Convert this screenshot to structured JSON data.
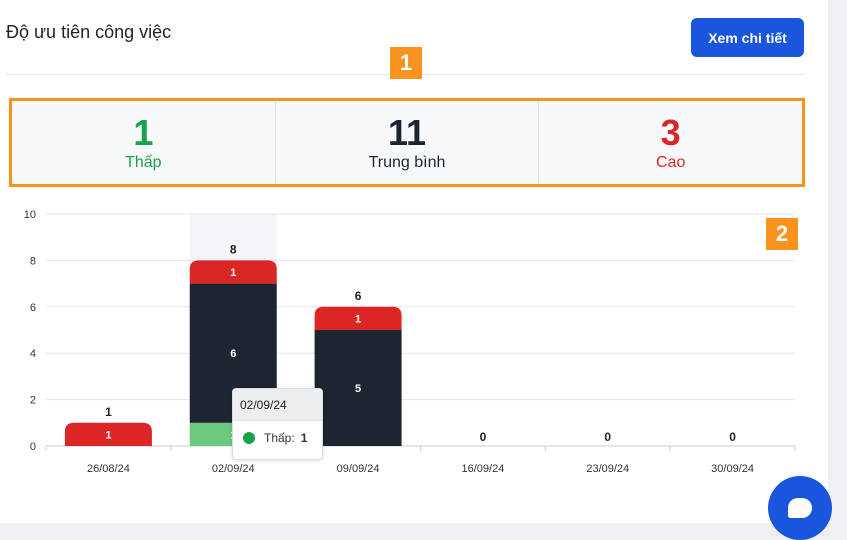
{
  "header": {
    "title": "Độ ưu tiên công việc",
    "detail_button": "Xem chi tiết"
  },
  "markers": {
    "summary": "1",
    "chart": "2"
  },
  "summary": [
    {
      "value": "1",
      "label": "Thấp",
      "color": "#16a34a"
    },
    {
      "value": "11",
      "label": "Trung bình",
      "color": "#1e2532"
    },
    {
      "value": "3",
      "label": "Cao",
      "color": "#dc2626"
    }
  ],
  "chart_data": {
    "type": "bar",
    "stacked": true,
    "categories": [
      "26/08/24",
      "02/09/24",
      "09/09/24",
      "16/09/24",
      "23/09/24",
      "30/09/24"
    ],
    "series": [
      {
        "name": "Thấp",
        "color": "#6cc97e",
        "values": [
          0,
          1,
          0,
          0,
          0,
          0
        ]
      },
      {
        "name": "Trung bình",
        "color": "#1e2532",
        "values": [
          0,
          6,
          5,
          0,
          0,
          0
        ]
      },
      {
        "name": "Cao",
        "color": "#dc2626",
        "values": [
          1,
          1,
          1,
          0,
          0,
          0
        ]
      }
    ],
    "totals": [
      1,
      8,
      6,
      0,
      0,
      0
    ],
    "ylim": [
      0,
      10
    ],
    "yticks": [
      0,
      2,
      4,
      6,
      8,
      10
    ],
    "grid": true,
    "highlight_category": "02/09/24"
  },
  "tooltip": {
    "title": "02/09/24",
    "label": "Thấp:",
    "value": "1",
    "dot_color": "#16a34a"
  }
}
